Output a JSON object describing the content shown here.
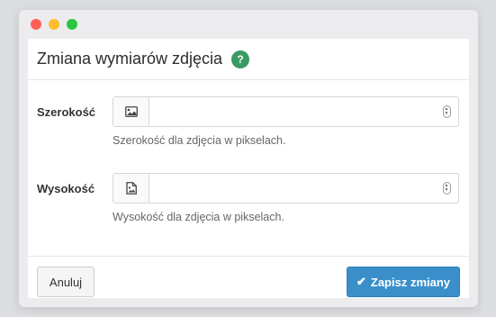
{
  "window": {
    "controls": [
      "close",
      "minimize",
      "maximize"
    ]
  },
  "dialog": {
    "title": "Zmiana wymiarów zdjęcia",
    "help_badge": "?",
    "help_color": "#3a9a63"
  },
  "fields": [
    {
      "label": "Szerokość",
      "icon": "image-icon",
      "value": "",
      "placeholder": "",
      "help": "Szerokość dla zdjęcia w pikselach."
    },
    {
      "label": "Wysokość",
      "icon": "file-image-icon",
      "value": "",
      "placeholder": "",
      "help": "Wysokość dla zdjęcia w pikselach."
    }
  ],
  "footer": {
    "cancel_label": "Anuluj",
    "save_label": "Zapisz zmiany",
    "save_icon": "check-icon",
    "save_color": "#3a8fcb"
  }
}
